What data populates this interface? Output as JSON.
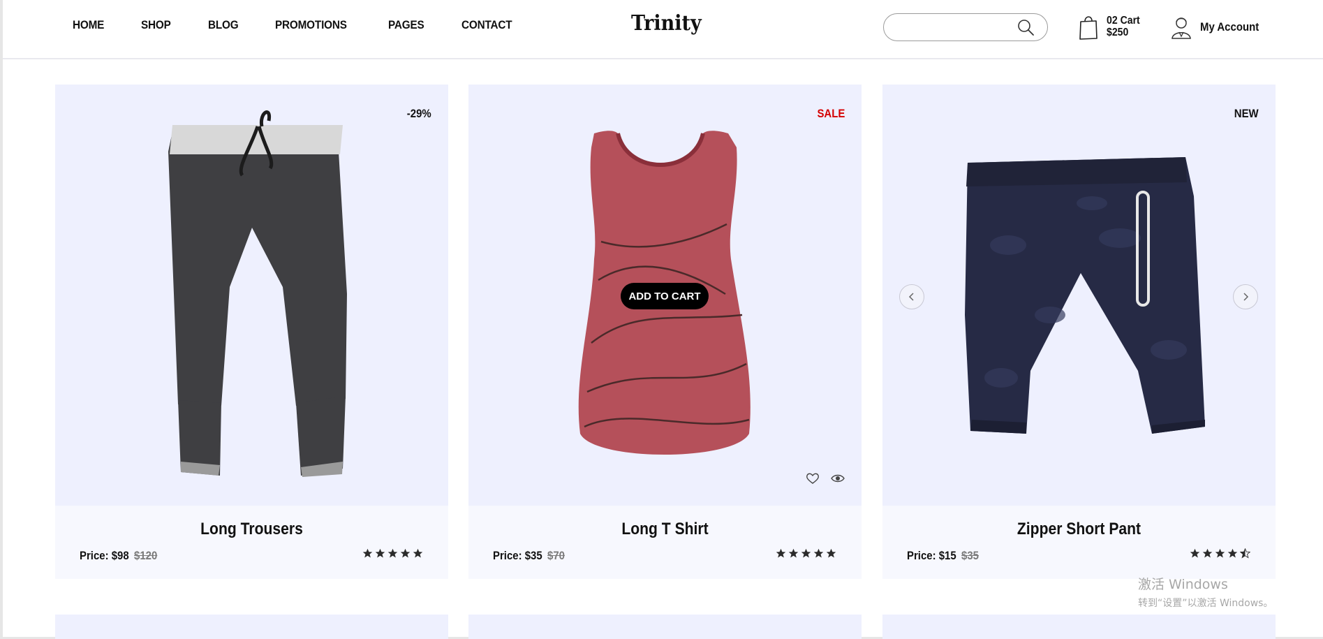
{
  "header": {
    "nav": [
      "HOME",
      "SHOP",
      "BLOG",
      "PROMOTIONS",
      "PAGES",
      "CONTACT"
    ],
    "logo": "Trinity",
    "search": {
      "placeholder": "",
      "value": ""
    },
    "cart": {
      "count_label": "02 Cart",
      "total": "$250"
    },
    "account": {
      "label": "My Account"
    }
  },
  "products": [
    {
      "name": "Long Trousers",
      "badge": "-29%",
      "price_label": "Price: $98",
      "old_price": "$120",
      "rating": 5
    },
    {
      "name": "Long T Shirt",
      "badge": "SALE",
      "price_label": "Price: $35",
      "old_price": "$70",
      "rating": 5,
      "add_to_cart": "ADD TO CART"
    },
    {
      "name": "Zipper Short Pant",
      "badge": "NEW",
      "price_label": "Price: $15",
      "old_price": "$35",
      "rating": 4.5
    }
  ],
  "colors": {
    "card_image_bg": "#eef0fe",
    "card_info_bg": "#f7f8fe",
    "sale": "#d40000",
    "pants": "#3f3f42",
    "tank": "#b5505a",
    "shorts": "#262a45"
  },
  "watermark": {
    "line1": "激活 Windows",
    "line2": "转到“设置”以激活 Windows。"
  }
}
